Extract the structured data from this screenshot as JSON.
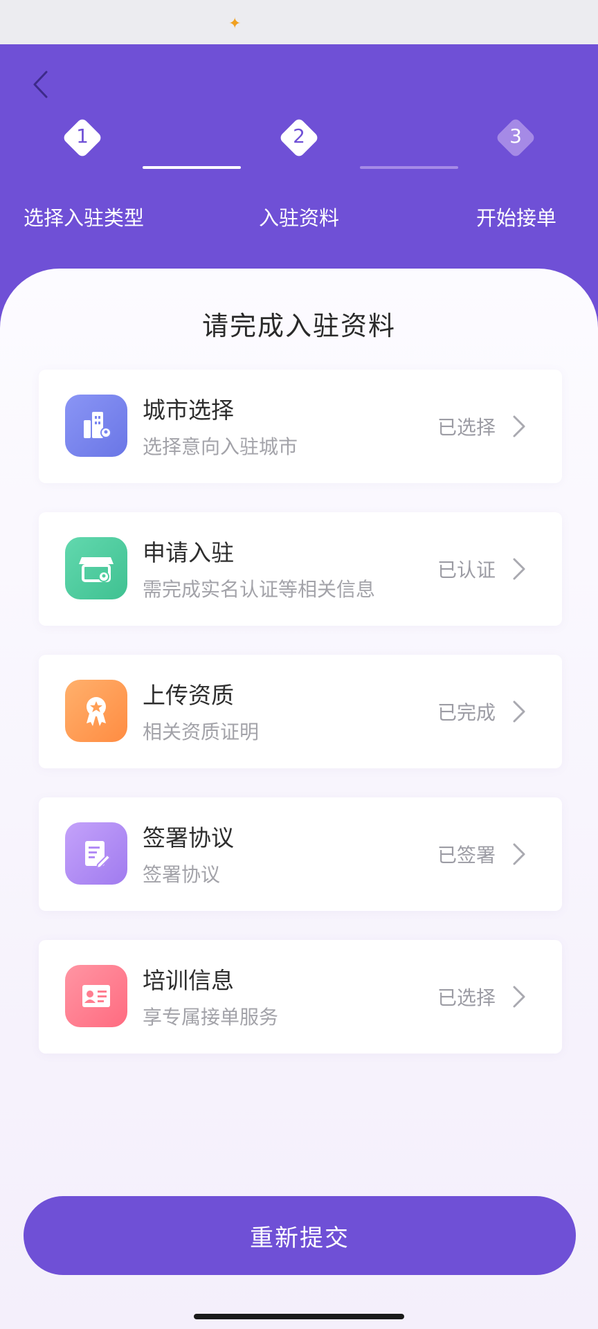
{
  "status_bar": {
    "left_text": "",
    "right_text": ""
  },
  "steps": [
    {
      "num": "1",
      "label": "选择入驻类型"
    },
    {
      "num": "2",
      "label": "入驻资料"
    },
    {
      "num": "3",
      "label": "开始接单"
    }
  ],
  "card_title": "请完成入驻资料",
  "items": [
    {
      "title": "城市选择",
      "subtitle": "选择意向入驻城市",
      "status": "已选择",
      "icon": "city-building-icon",
      "icon_color": "#7a86f0"
    },
    {
      "title": "申请入驻",
      "subtitle": "需完成实名认证等相关信息",
      "status": "已认证",
      "icon": "storefront-icon",
      "icon_color": "#4fcfa0"
    },
    {
      "title": "上传资质",
      "subtitle": "相关资质证明",
      "status": "已完成",
      "icon": "award-badge-icon",
      "icon_color": "#ff9f56"
    },
    {
      "title": "签署协议",
      "subtitle": "签署协议",
      "status": "已签署",
      "icon": "document-sign-icon",
      "icon_color": "#b28cf5"
    },
    {
      "title": "培训信息",
      "subtitle": "享专属接单服务",
      "status": "已选择",
      "icon": "id-card-icon",
      "icon_color": "#ff7e90"
    }
  ],
  "submit_label": "重新提交",
  "colors": {
    "primary": "#6f50d6",
    "background": "#f6f2fc"
  }
}
